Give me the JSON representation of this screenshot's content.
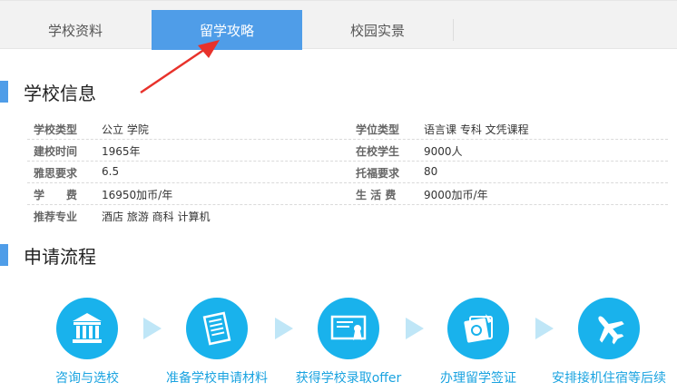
{
  "tabs": [
    {
      "label": "学校资料",
      "active": false
    },
    {
      "label": "留学攻略",
      "active": true
    },
    {
      "label": "校园实景",
      "active": false
    }
  ],
  "colors": {
    "accent": "#4f9de8",
    "step_circle": "#19b2ec",
    "step_text": "#1aa3e0",
    "arrow": "#e8322b"
  },
  "school_info": {
    "title": "学校信息",
    "rows": [
      {
        "k1": "学校类型",
        "v1": "公立 学院",
        "k2": "学位类型",
        "v2": "语言课 专科 文凭课程"
      },
      {
        "k1": "建校时间",
        "v1": "1965年",
        "k2": "在校学生",
        "v2": "9000人"
      },
      {
        "k1": "雅思要求",
        "v1": "6.5",
        "k2": "托福要求",
        "v2": "80"
      },
      {
        "k1": "学　　费",
        "v1": "16950加币/年",
        "k2": "生 活 费",
        "v2": "9000加币/年"
      },
      {
        "k1": "推荐专业",
        "v1": "酒店 旅游 商科 计算机",
        "k2": "",
        "v2": ""
      }
    ]
  },
  "process": {
    "title": "申请流程",
    "steps": [
      {
        "label": "咨询与选校",
        "icon": "bank-icon"
      },
      {
        "label": "准备学校申请材料",
        "icon": "document-icon"
      },
      {
        "label": "获得学校录取offer",
        "icon": "certificate-icon"
      },
      {
        "label": "办理留学签证",
        "icon": "passport-icon"
      },
      {
        "label": "安排接机住宿等后续",
        "icon": "airplane-icon"
      }
    ]
  }
}
